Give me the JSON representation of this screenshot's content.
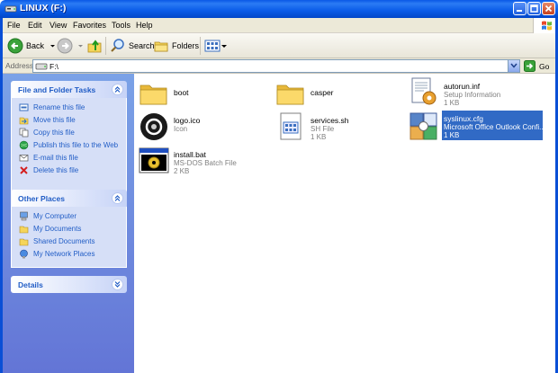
{
  "window": {
    "title": "LINUX (F:)"
  },
  "menu": [
    "File",
    "Edit",
    "View",
    "Favorites",
    "Tools",
    "Help"
  ],
  "toolbar": {
    "back_label": "Back",
    "search_label": "Search",
    "folders_label": "Folders"
  },
  "address": {
    "label": "Address",
    "value": "F:\\",
    "go_label": "Go"
  },
  "tasks_panel": {
    "title": "File and Folder Tasks",
    "items": [
      {
        "label": "Rename this file",
        "icon": "rename-icon"
      },
      {
        "label": "Move this file",
        "icon": "move-icon"
      },
      {
        "label": "Copy this file",
        "icon": "copy-icon"
      },
      {
        "label": "Publish this file to the Web",
        "icon": "publish-web-icon"
      },
      {
        "label": "E-mail this file",
        "icon": "email-icon"
      },
      {
        "label": "Delete this file",
        "icon": "delete-icon"
      }
    ]
  },
  "places_panel": {
    "title": "Other Places",
    "items": [
      {
        "label": "My Computer",
        "icon": "computer-icon"
      },
      {
        "label": "My Documents",
        "icon": "folder-icon"
      },
      {
        "label": "Shared Documents",
        "icon": "folder-icon"
      },
      {
        "label": "My Network Places",
        "icon": "network-icon"
      }
    ]
  },
  "details_panel": {
    "title": "Details"
  },
  "files": [
    {
      "name": "boot",
      "type": "",
      "size": "",
      "icon": "folder-icon",
      "selected": false
    },
    {
      "name": "casper",
      "type": "",
      "size": "",
      "icon": "folder-icon",
      "selected": false
    },
    {
      "name": "autorun.inf",
      "type": "Setup Information",
      "size": "1 KB",
      "icon": "setup-info-icon",
      "selected": false
    },
    {
      "name": "logo.ico",
      "type": "Icon",
      "size": "",
      "icon": "ubuntu-logo-icon",
      "selected": false
    },
    {
      "name": "services.sh",
      "type": "SH File",
      "size": "1 KB",
      "icon": "generic-file-icon",
      "selected": false
    },
    {
      "name": "syslinux.cfg",
      "type": "Microsoft Office Outlook Confi...",
      "size": "1 KB",
      "icon": "outlook-config-icon",
      "selected": true
    },
    {
      "name": "install.bat",
      "type": "MS-DOS Batch File",
      "size": "2 KB",
      "icon": "batch-file-icon",
      "selected": false
    }
  ],
  "colors": {
    "titlebar": "#0a58e6",
    "selection": "#316ac5",
    "task_link": "#215dc6",
    "left_pane": "#7ba2e7"
  }
}
